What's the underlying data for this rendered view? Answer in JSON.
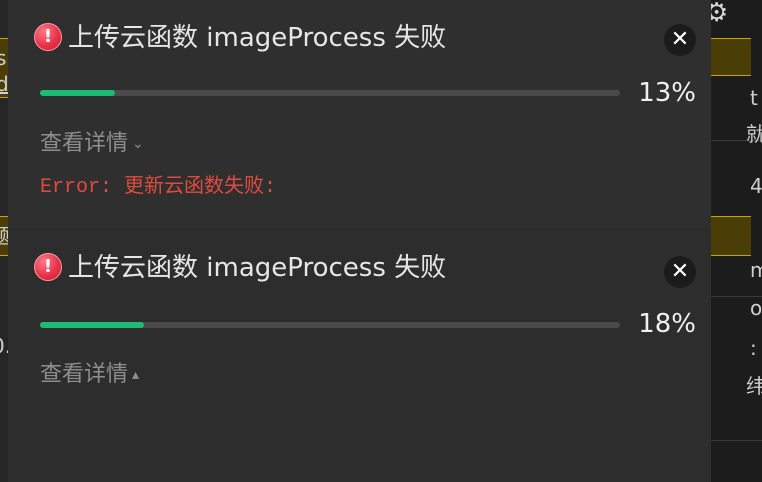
{
  "background": {
    "left_fragments": [
      "s",
      "d",
      "题",
      "0."
    ],
    "right_fragments": [
      "t",
      "就",
      "4",
      "m",
      "o",
      ":",
      "纬"
    ]
  },
  "notifications": [
    {
      "title": "上传云函数 imageProcess 失败",
      "progress_percent_value": 13,
      "progress_text": "13%",
      "details_label": "查看详情",
      "details_chevron": "⌄",
      "error_prefix": "Error:",
      "error_message": "更新云函数失败:",
      "close_glyph": "✕",
      "icon_glyph": "!",
      "expanded": true
    },
    {
      "title": "上传云函数 imageProcess 失败",
      "progress_percent_value": 18,
      "progress_text": "18%",
      "details_label": "查看详情",
      "details_chevron": "▴",
      "close_glyph": "✕",
      "icon_glyph": "!",
      "expanded": false
    }
  ],
  "colors": {
    "progress_fill": "#1dbb73",
    "error_text": "#e04b3e",
    "error_icon": "#e8334a",
    "highlight_band": "#4a3d06"
  },
  "icons": {
    "error": "error-circle-icon",
    "close": "close-icon",
    "gear": "gear-icon",
    "chevron_down": "chevron-down-icon",
    "chevron_up": "chevron-up-icon"
  },
  "gear_glyph": "⚙"
}
